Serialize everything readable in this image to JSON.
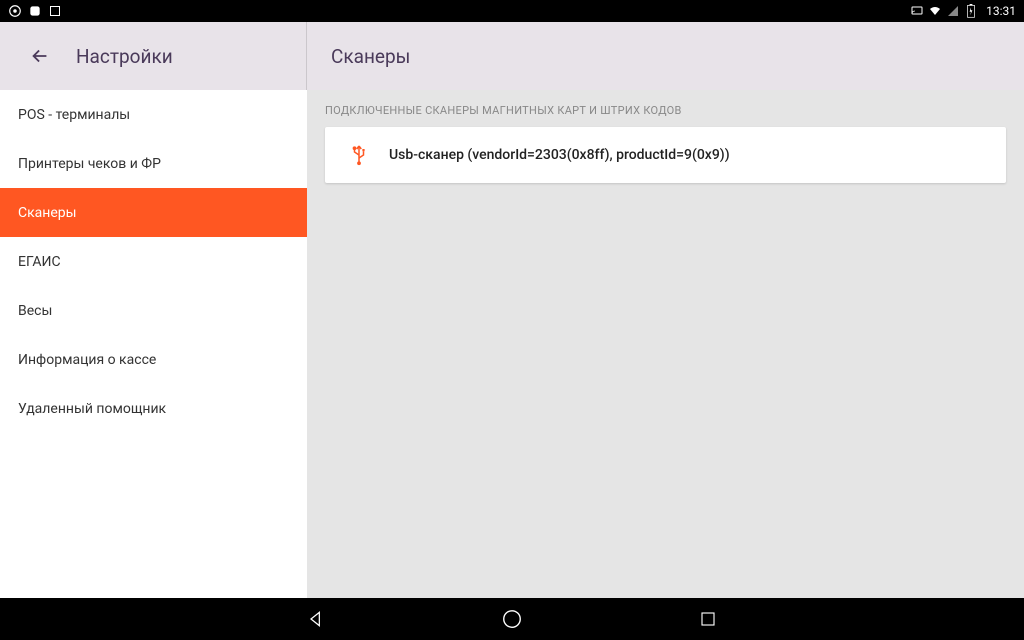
{
  "status": {
    "time": "13:31"
  },
  "header": {
    "left_title": "Настройки",
    "right_title": "Сканеры"
  },
  "sidebar": {
    "items": [
      {
        "label": "POS - терминалы"
      },
      {
        "label": "Принтеры чеков и ФР"
      },
      {
        "label": "Сканеры"
      },
      {
        "label": "ЕГАИС"
      },
      {
        "label": "Весы"
      },
      {
        "label": "Информация о кассе"
      },
      {
        "label": "Удаленный помощник"
      }
    ]
  },
  "content": {
    "section_label": "ПОДКЛЮЧЕННЫЕ СКАНЕРЫ МАГНИТНЫХ КАРТ И ШТРИХ КОДОВ",
    "devices": [
      {
        "label": "Usb-сканер (vendorId=2303(0x8ff), productId=9(0x9))"
      }
    ]
  },
  "colors": {
    "accent": "#ff5722",
    "header_bg": "#e8e3e9",
    "header_text": "#4a3a5a"
  }
}
